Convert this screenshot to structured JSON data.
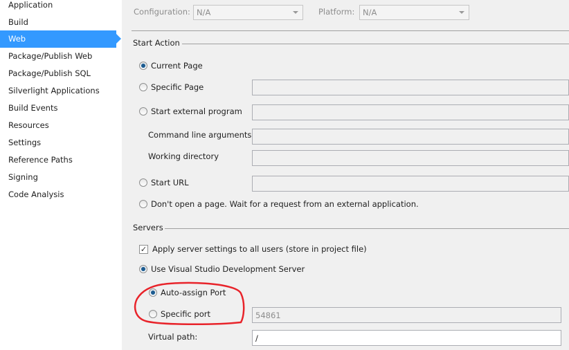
{
  "sidebar": {
    "items": [
      {
        "label": "Application",
        "selected": false
      },
      {
        "label": "Build",
        "selected": false
      },
      {
        "label": "Web",
        "selected": true
      },
      {
        "label": "Package/Publish Web",
        "selected": false
      },
      {
        "label": "Package/Publish SQL",
        "selected": false
      },
      {
        "label": "Silverlight Applications",
        "selected": false
      },
      {
        "label": "Build Events",
        "selected": false
      },
      {
        "label": "Resources",
        "selected": false
      },
      {
        "label": "Settings",
        "selected": false
      },
      {
        "label": "Reference Paths",
        "selected": false
      },
      {
        "label": "Signing",
        "selected": false
      },
      {
        "label": "Code Analysis",
        "selected": false
      }
    ]
  },
  "header": {
    "configuration_label": "Configuration:",
    "configuration_value": "N/A",
    "platform_label": "Platform:",
    "platform_value": "N/A"
  },
  "start_action": {
    "title": "Start Action",
    "current_page": "Current Page",
    "specific_page": "Specific Page",
    "start_external": "Start external program",
    "command_line_args": "Command line arguments",
    "working_directory": "Working directory",
    "start_url": "Start URL",
    "dont_open": "Don't open a page.  Wait for a request from an external application.",
    "selected": "Current Page"
  },
  "servers": {
    "title": "Servers",
    "apply_settings": "Apply server settings to all users (store in project file)",
    "apply_settings_checked": true,
    "use_vs_dev_server": "Use Visual Studio Development Server",
    "auto_assign_port": "Auto-assign Port",
    "specific_port": "Specific port",
    "port_value": "54861",
    "virtual_path_label": "Virtual path:",
    "virtual_path_value": "/"
  },
  "annotation_color": "#e8232a"
}
